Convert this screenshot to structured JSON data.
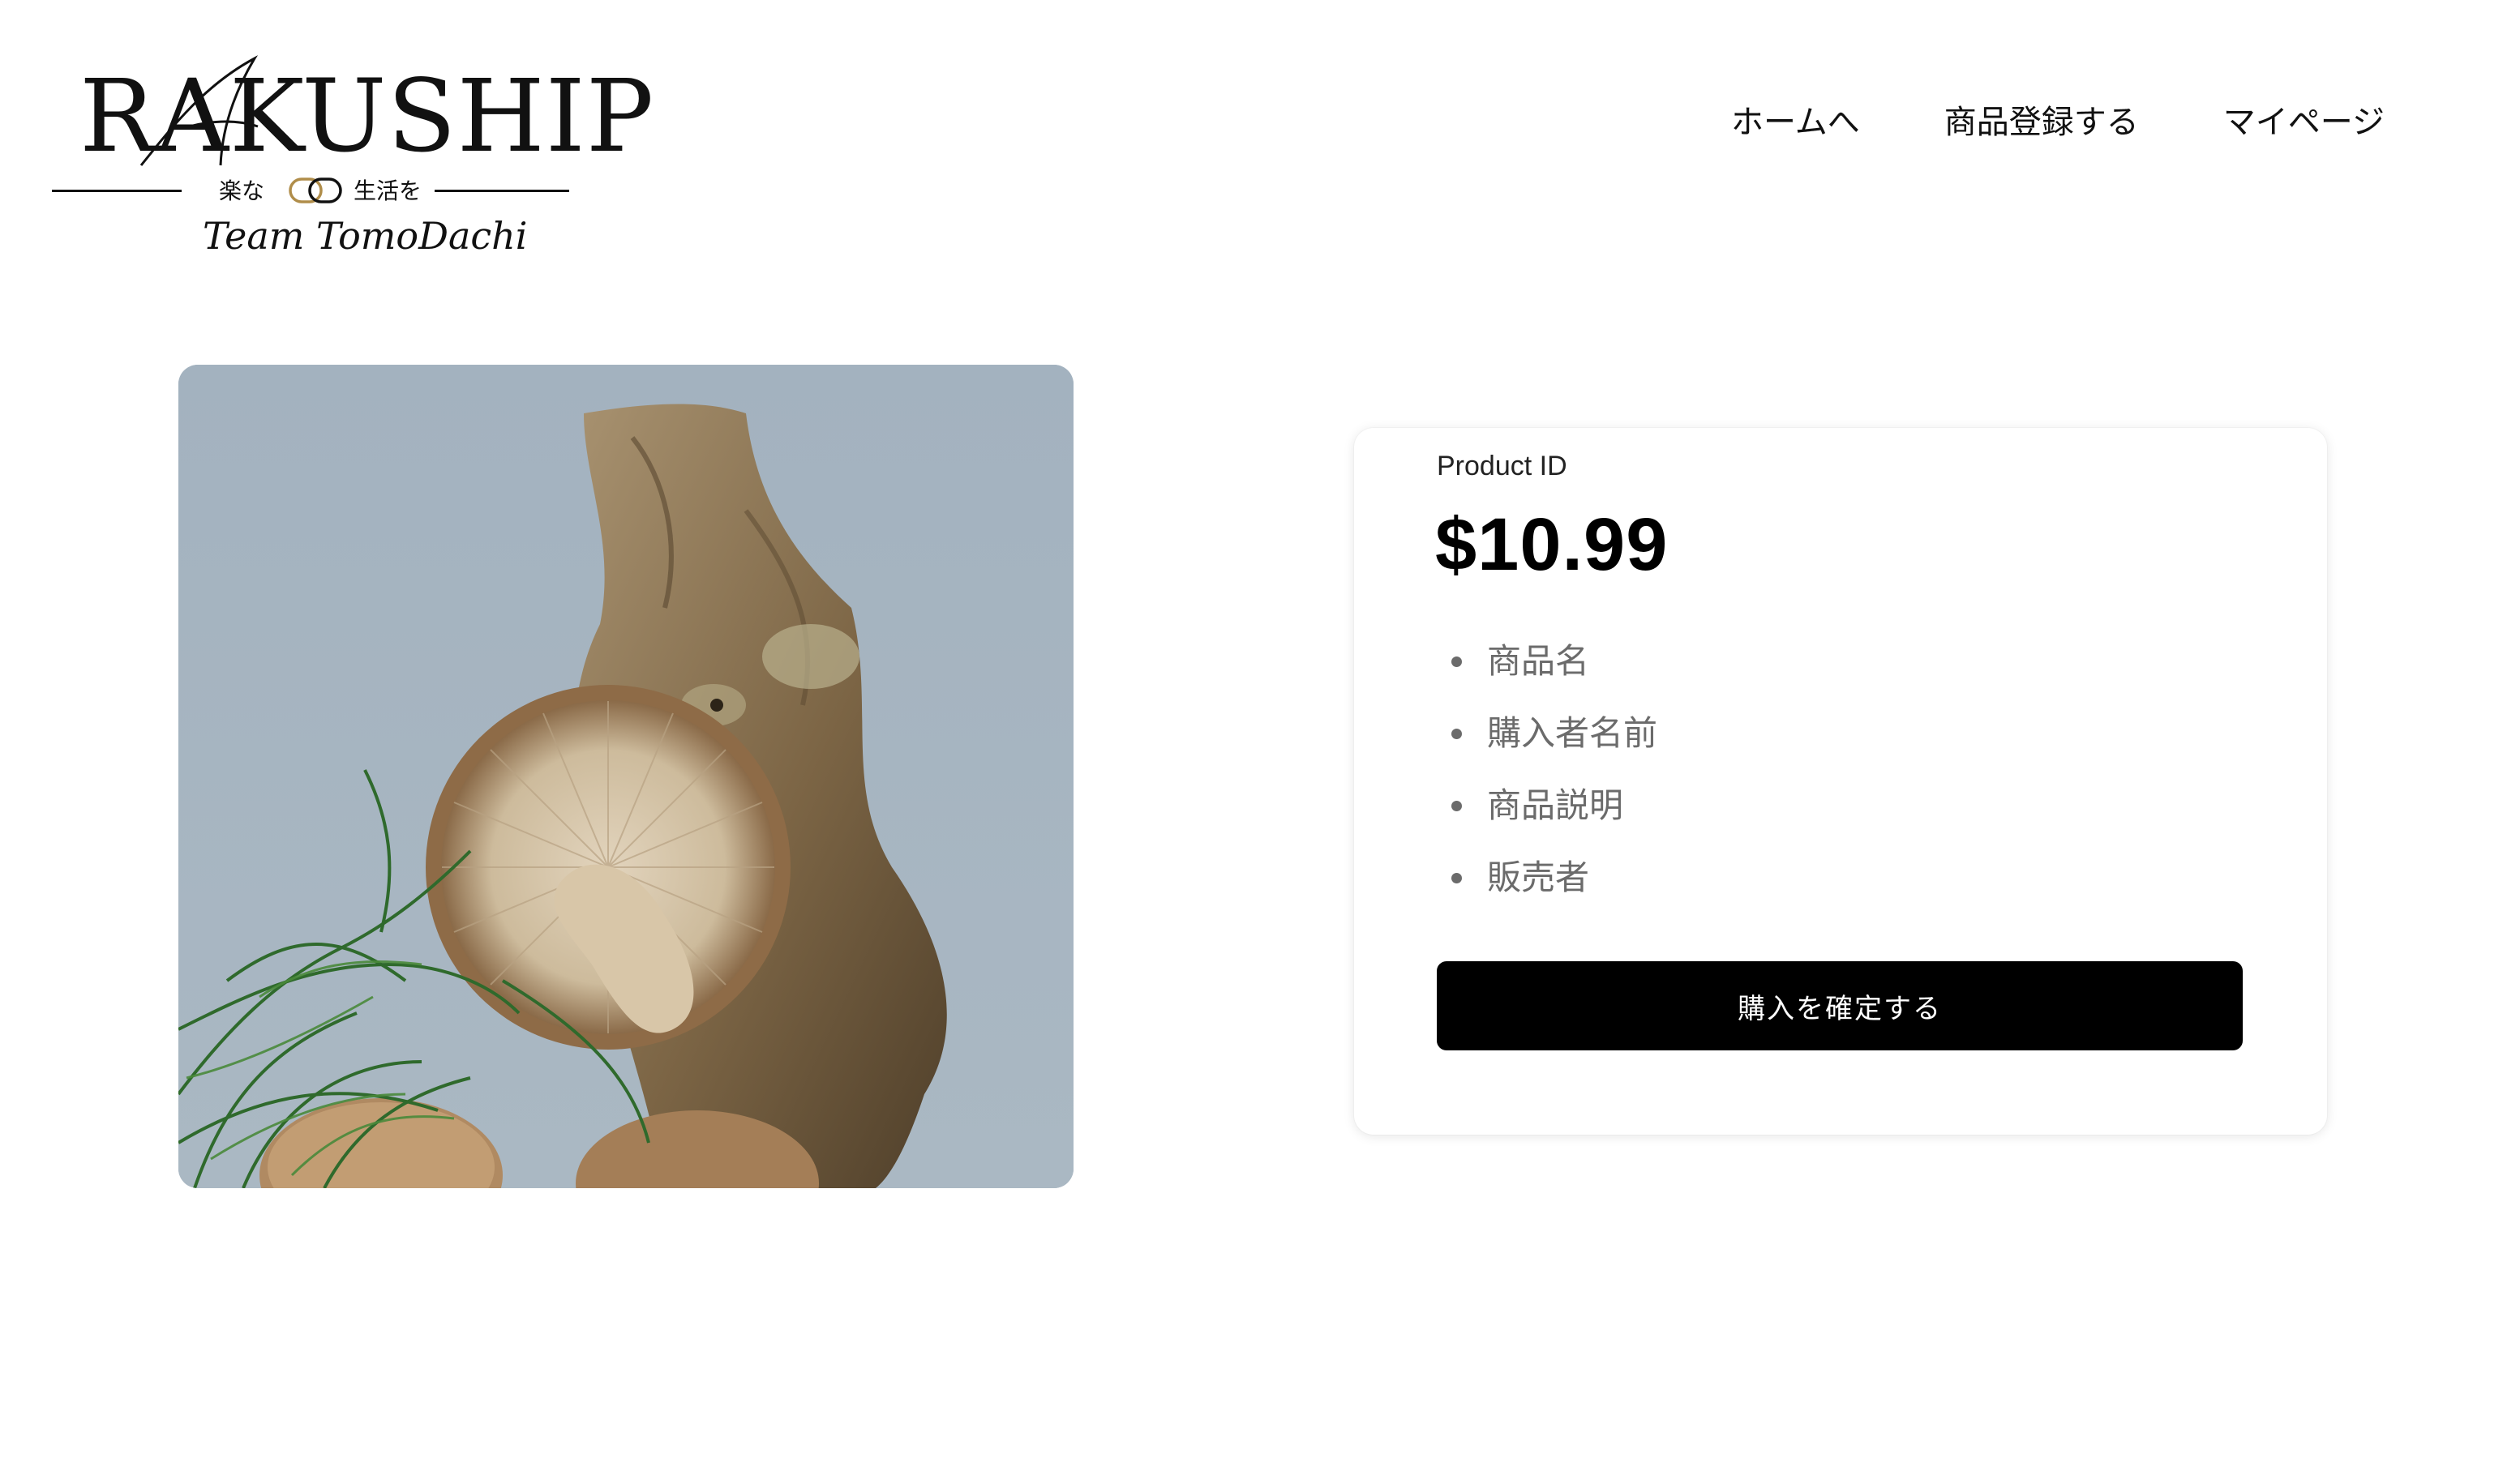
{
  "header": {
    "logo": {
      "wordmark": "RAKUSHIP",
      "tagline_left": "楽な",
      "tagline_right": "生活を",
      "team": "Team TomoDachi"
    },
    "nav": [
      {
        "label": "ホームへ"
      },
      {
        "label": "商品登録する"
      },
      {
        "label": "マイページ"
      }
    ]
  },
  "product": {
    "image": {
      "icon": "mushroom-photo"
    },
    "id_label": "Product ID",
    "price": "$10.99",
    "details": [
      {
        "label": "商品名"
      },
      {
        "label": "購入者名前"
      },
      {
        "label": "商品説明"
      },
      {
        "label": "販売者"
      }
    ],
    "buy_button": "購入を確定する"
  },
  "colors": {
    "button_bg": "#000000",
    "button_text": "#ffffff",
    "muted_text": "#6b6b6b",
    "image_bg": "#a4b3c0"
  }
}
